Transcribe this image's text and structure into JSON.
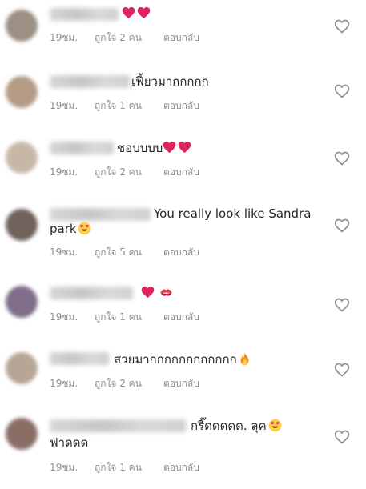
{
  "comments": [
    {
      "text": "",
      "emojis": [
        "red-heart",
        "red-heart"
      ],
      "time": "19ชม.",
      "likes": "ถูกใจ 2 คน",
      "reply": "ตอบกลับ",
      "avatar_color": "#9c8f83"
    },
    {
      "text": "เฟี้ยวมากกกกก",
      "emojis": [],
      "time": "19ชม.",
      "likes": "ถูกใจ 1 คน",
      "reply": "ตอบกลับ",
      "avatar_color": "#b59b85"
    },
    {
      "text": "ชอบบบบ",
      "emojis": [
        "red-heart",
        "red-heart"
      ],
      "time": "19ชม.",
      "likes": "ถูกใจ 2 คน",
      "reply": "ตอบกลับ",
      "avatar_color": "#c7b7a6"
    },
    {
      "text": "You really look like Sandra",
      "text2": "park",
      "emojis": [
        "heart-eyes"
      ],
      "time": "19ชม.",
      "likes": "ถูกใจ 5 คน",
      "reply": "ตอบกลับ",
      "avatar_color": "#6f625a"
    },
    {
      "text": "",
      "emojis": [
        "red-heart",
        "kiss-mark"
      ],
      "time": "19ชม.",
      "likes": "ถูกใจ 1 คน",
      "reply": "ตอบกลับ",
      "avatar_color": "#7f6d8a"
    },
    {
      "text": "สวยมากกกกกกกกกกกก",
      "emojis": [
        "fire"
      ],
      "time": "19ชม.",
      "likes": "ถูกใจ 2 คน",
      "reply": "ตอบกลับ",
      "avatar_color": "#b7a696"
    },
    {
      "text": "กรี๊ดดดดด. ลุค",
      "text2": "ฟาดดด",
      "emojis": [
        "heart-eyes"
      ],
      "time": "19ชม.",
      "likes": "ถูกใจ 1 คน",
      "reply": "ตอบกลับ",
      "avatar_color": "#8a6e66"
    }
  ],
  "like_icon": "heart-outline-icon",
  "colors": {
    "meta": "#8e8e8e",
    "text": "#262626",
    "heart": "#e0245e"
  }
}
